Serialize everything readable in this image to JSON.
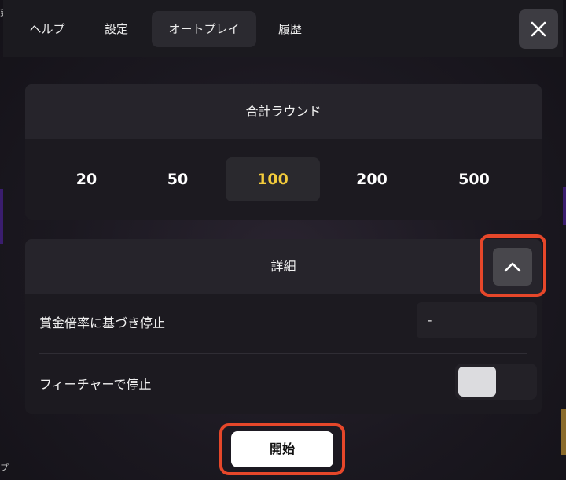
{
  "tabs": [
    {
      "label": "ヘルプ",
      "active": false
    },
    {
      "label": "設定",
      "active": false
    },
    {
      "label": "オートプレイ",
      "active": true
    },
    {
      "label": "履歴",
      "active": false
    }
  ],
  "close_icon": "close-icon",
  "total_rounds": {
    "title": "合計ラウンド",
    "options": [
      "20",
      "50",
      "100",
      "200",
      "500"
    ],
    "selected": "100"
  },
  "details": {
    "title": "詳細",
    "expanded": true,
    "collapse_icon": "chevron-up-icon",
    "stop_on_multiplier": {
      "label": "賞金倍率に基づき停止",
      "value": "-"
    },
    "stop_on_feature": {
      "label": "フィーチャーで停止",
      "on": false
    }
  },
  "start_label": "開始",
  "edge_glyphs": {
    "top_left": "到",
    "bottom_left": "プ"
  },
  "colors": {
    "selected": "#f3cb3b",
    "highlight": "#e6472a",
    "panel": "#1c1a20"
  }
}
